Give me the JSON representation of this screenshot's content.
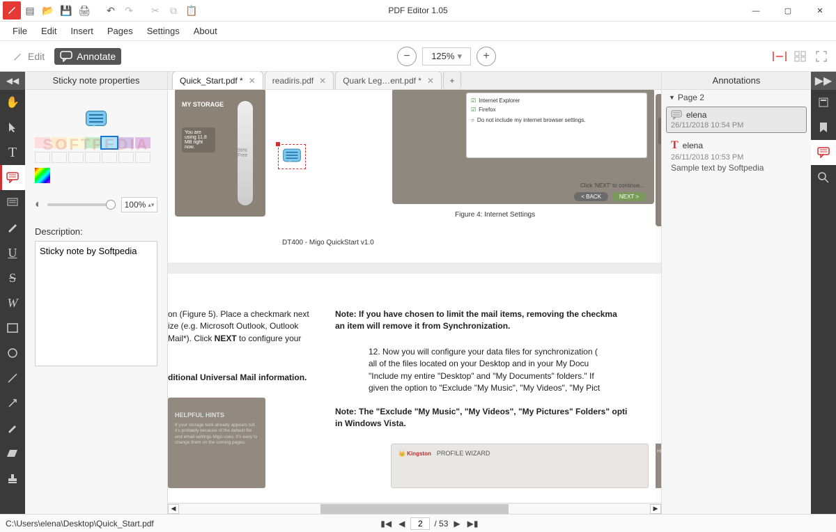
{
  "window": {
    "title": "PDF Editor 1.05"
  },
  "menubar": [
    "File",
    "Edit",
    "Insert",
    "Pages",
    "Settings",
    "About"
  ],
  "modes": {
    "edit": "Edit",
    "annotate": "Annotate"
  },
  "zoom": "125%",
  "left_panel": {
    "title": "Sticky note properties",
    "opacity": "100%",
    "desc_label": "Description:",
    "description": "Sticky note by Softpedia"
  },
  "tabs": [
    {
      "label": "Quick_Start.pdf *",
      "active": true
    },
    {
      "label": "readiris.pdf",
      "active": false
    },
    {
      "label": "Quark Leg…ent.pdf *",
      "active": false
    }
  ],
  "document": {
    "fig_caption": "Figure 4: Internet Settings",
    "storage_title": "MY STORAGE",
    "footer_line": "DT400 - Migo QuickStart v1.0",
    "ie": "Internet Explorer",
    "firefox": "Firefox",
    "noinclude": "Do not include my internet browser settings.",
    "next_hint": "Click 'NEXT' to continue...",
    "back_btn": "< BACK",
    "next_btn": "NEXT >",
    "note_p1": "Note: If you have chosen to limit the mail items, removing the checkma",
    "note_p1b": "an item will remove it from Synchronization.",
    "li12a": "Now you will configure your data files for synchronization (",
    "li12b": "all of the files located on your Desktop and in your My Docu",
    "li12c": "\"Include my entire \"Desktop\" and \"My Documents\" folders.\" If",
    "li12d": "given the option to \"Exclude \"My Music\", \"My Videos\", \"My Pict",
    "note_p2": "Note: The \"Exclude \"My Music\", \"My Videos\", \"My Pictures\" Folders\" opti",
    "note_p2b": "in Windows Vista.",
    "left_frag1a": "on (Figure 5). Place a checkmark next",
    "left_frag1b": "ize (e.g. Microsoft Outlook, Outlook",
    "left_frag1c": " Mail*). Click ",
    "left_frag1d": " to configure your",
    "left_frag1_next": "NEXT",
    "left_frag2": "ditional Universal Mail information.",
    "hints_title": "HELPFUL HINTS",
    "profile_wizard": "PROFILE WIZARD",
    "hints_body": "If your storage tank already appears full, it's probably because of the default file and email settings Migo uses. It's easy to change them on the coming pages.",
    "storage_info": "You are using 11.8 MB right now.",
    "storage_free": "99% Free"
  },
  "annotations": {
    "title": "Annotations",
    "section": "Page 2",
    "items": [
      {
        "user": "elena",
        "time": "26/11/2018 10:54 PM",
        "selected": true,
        "icon": "note"
      },
      {
        "user": "elena",
        "time": "26/11/2018 10:53 PM",
        "snippet": "Sample text by Softpedia",
        "icon": "text"
      }
    ]
  },
  "status": {
    "path": "C:\\Users\\elena\\Desktop\\Quick_Start.pdf",
    "page": "2",
    "total": "/ 53"
  },
  "watermark": "SOFTPEDIA"
}
